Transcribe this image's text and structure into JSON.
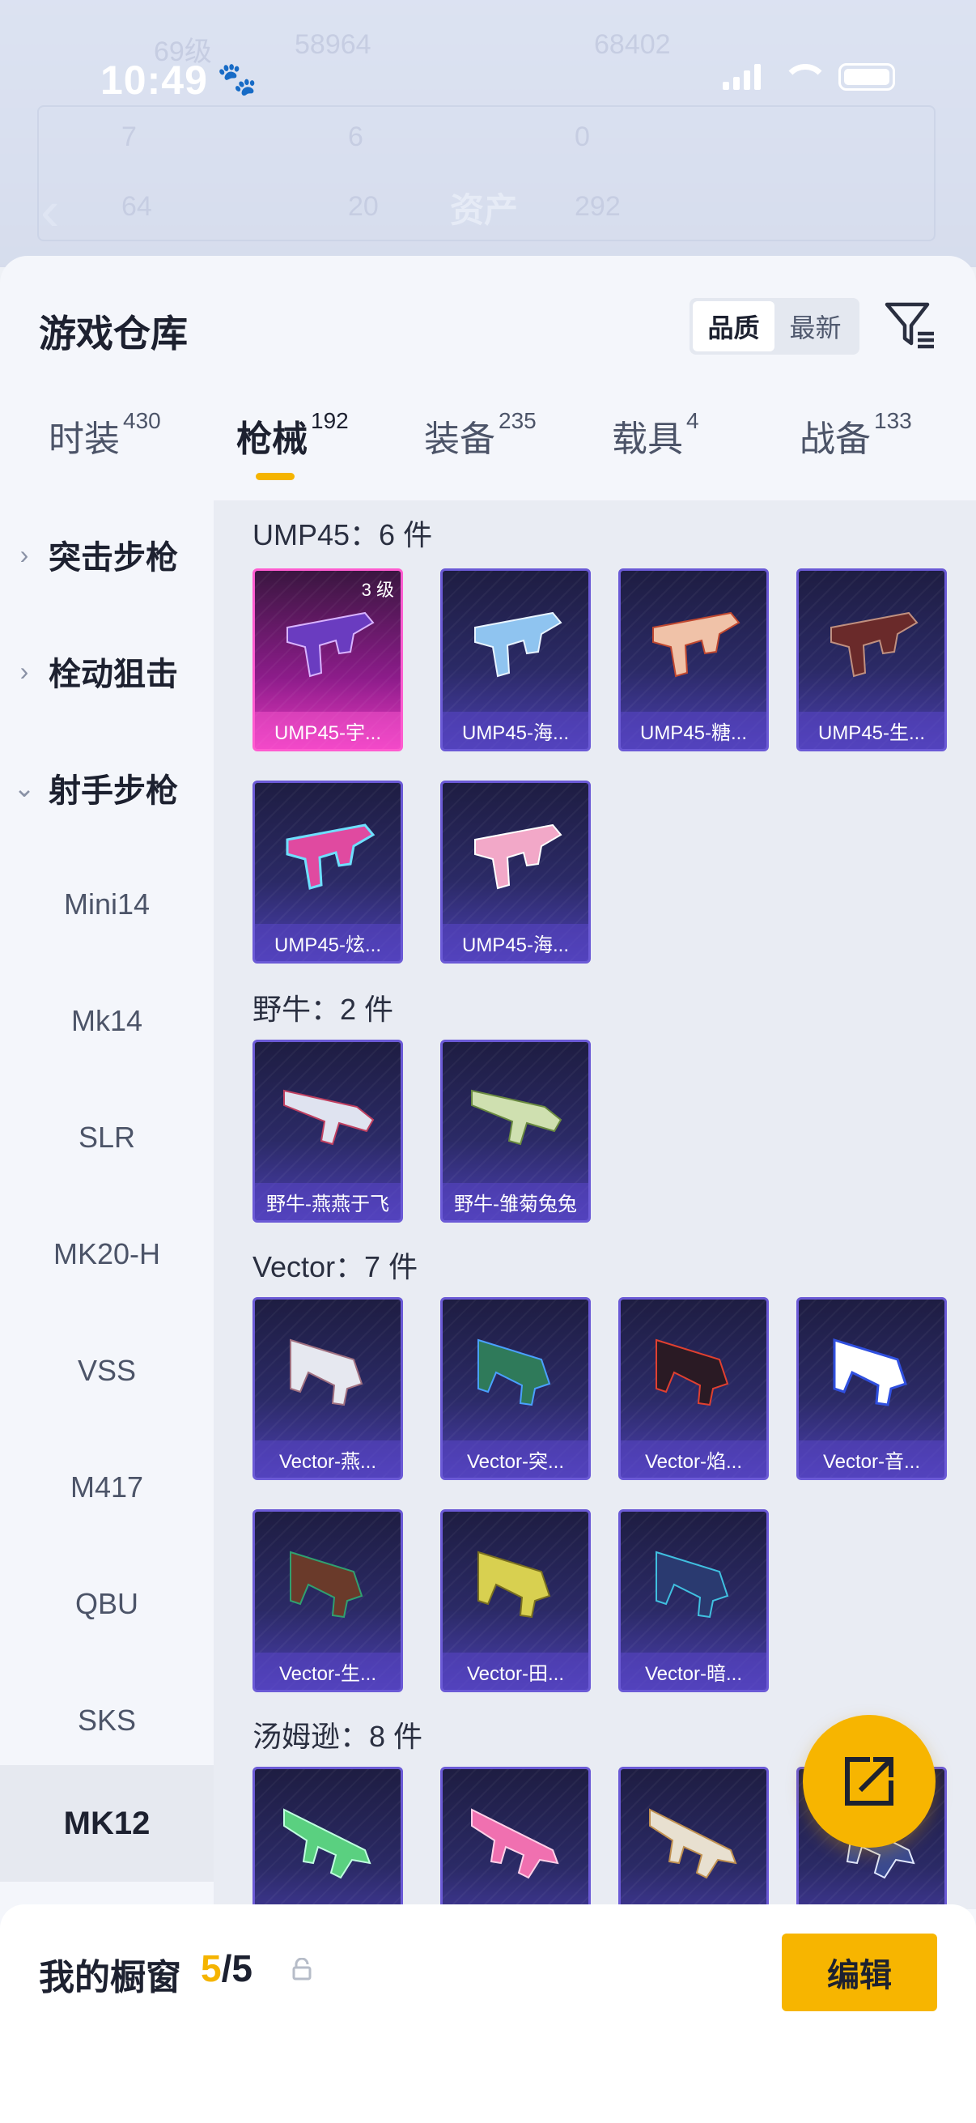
{
  "status_bar": {
    "time": "10:49"
  },
  "header": {
    "title": "资产",
    "faded": {
      "level": "69级",
      "score_left": "58964",
      "score_right": "68402",
      "r1a": "7",
      "r1b": "6",
      "r1c": "0",
      "r2a": "64",
      "r2b": "20",
      "r2c": "292"
    }
  },
  "sheet": {
    "title": "游戏仓库",
    "sort": {
      "options": [
        "品质",
        "最新"
      ],
      "active": "品质"
    }
  },
  "tabs": [
    {
      "label": "时装",
      "count": "430"
    },
    {
      "label": "枪械",
      "count": "192",
      "active": true
    },
    {
      "label": "装备",
      "count": "235"
    },
    {
      "label": "载具",
      "count": "4"
    },
    {
      "label": "战备",
      "count": "133"
    }
  ],
  "nav": {
    "categories": [
      {
        "label": "突击步枪",
        "expanded": false
      },
      {
        "label": "栓动狙击",
        "expanded": false
      },
      {
        "label": "射手步枪",
        "expanded": true
      }
    ],
    "subitems": [
      "Mini14",
      "Mk14",
      "SLR",
      "MK20-H",
      "VSS",
      "M417",
      "QBU",
      "SKS",
      "MK12"
    ],
    "active_subitem": "MK12"
  },
  "sections": [
    {
      "title": "UMP45：6 件",
      "items": [
        "UMP45-宇...",
        "UMP45-海...",
        "UMP45-糖...",
        "UMP45-生...",
        "UMP45-炫...",
        "UMP45-海..."
      ],
      "first_badge": "3 级"
    },
    {
      "title": "野牛：2 件",
      "items": [
        "野牛-燕燕于飞",
        "野牛-雏菊兔兔"
      ]
    },
    {
      "title": "Vector：7 件",
      "items": [
        "Vector-燕...",
        "Vector-突...",
        "Vector-焰...",
        "Vector-音...",
        "Vector-生...",
        "Vector-田...",
        "Vector-暗..."
      ]
    },
    {
      "title": "汤姆逊：8 件",
      "items": [
        "",
        "",
        "",
        ""
      ]
    }
  ],
  "showcase": {
    "label": "我的橱窗",
    "current": "5",
    "total": "/5",
    "edit_label": "编辑"
  },
  "colors": {
    "accent": "#f7b500",
    "card_purple": "#4b3fb0",
    "card_pink": "#e83ac0"
  }
}
